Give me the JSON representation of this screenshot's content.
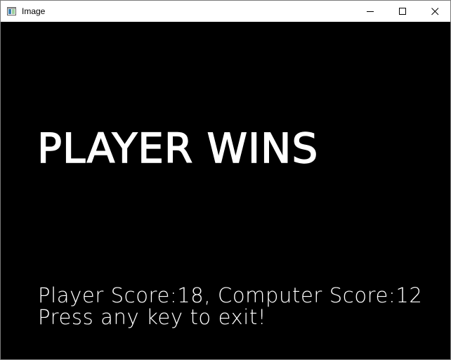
{
  "window": {
    "title": "Image",
    "controls": {
      "minimize": "minimize-icon",
      "maximize": "maximize-icon",
      "close": "close-icon"
    }
  },
  "canvas": {
    "background": "#000000",
    "text_color": "#ffffff",
    "headline": "PLAYER WINS",
    "score_line": "Player Score:18, Computer Score:12",
    "prompt_line": "Press any key to exit!"
  }
}
